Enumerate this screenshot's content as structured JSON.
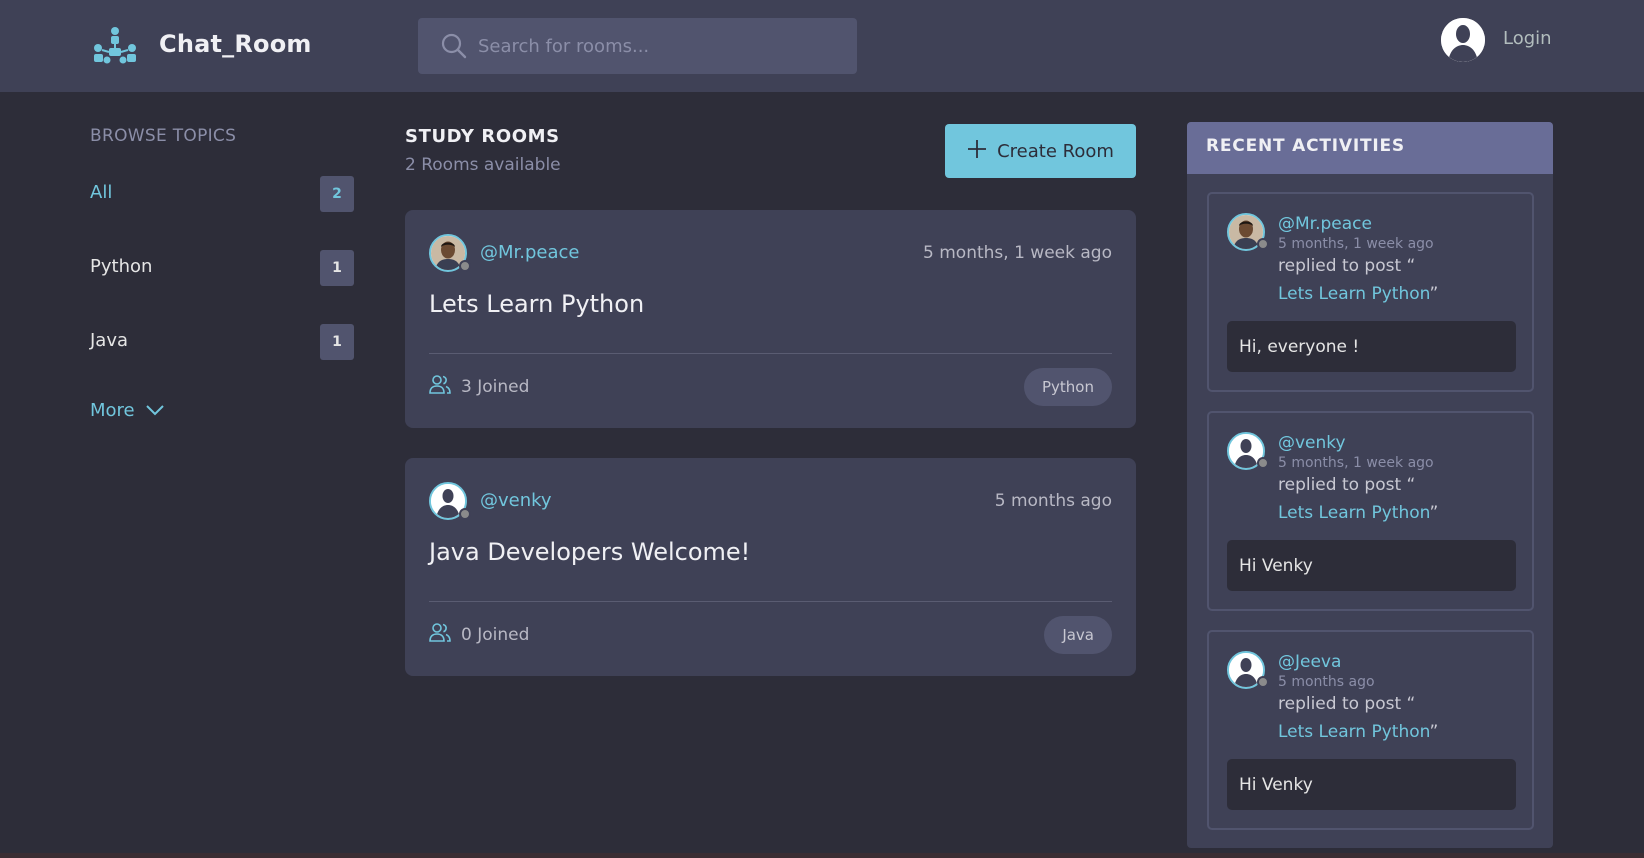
{
  "header": {
    "brand": "Chat_Room",
    "search_placeholder": "Search for rooms...",
    "login_label": "Login"
  },
  "sidebar": {
    "title": "BROWSE TOPICS",
    "topics": [
      {
        "name": "All",
        "count": "2"
      },
      {
        "name": "Python",
        "count": "1"
      },
      {
        "name": "Java",
        "count": "1"
      }
    ],
    "more_label": "More"
  },
  "main": {
    "title": "STUDY ROOMS",
    "subtitle": "2 Rooms available",
    "create_label": "Create Room",
    "rooms": [
      {
        "author": "@Mr.peace",
        "time": "5 months, 1 week ago",
        "title": "Lets Learn Python",
        "joined": "3 Joined",
        "tag": "Python"
      },
      {
        "author": "@venky",
        "time": "5 months ago",
        "title": "Java Developers Welcome!",
        "joined": "0 Joined",
        "tag": "Java"
      }
    ]
  },
  "activities": {
    "title": "RECENT ACTIVITIES",
    "items": [
      {
        "user": "@Mr.peace",
        "time": "5 months, 1 week ago",
        "action": "replied to post “",
        "post": "Lets Learn Python",
        "close": "”",
        "message": "Hi, everyone !"
      },
      {
        "user": "@venky",
        "time": "5 months, 1 week ago",
        "action": "replied to post “",
        "post": "Lets Learn Python",
        "close": "”",
        "message": "Hi Venky"
      },
      {
        "user": "@Jeeva",
        "time": "5 months ago",
        "action": "replied to post “",
        "post": "Lets Learn Python",
        "close": "”",
        "message": "Hi Venky"
      }
    ]
  },
  "colors": {
    "background": "#2d2d39",
    "panel": "#3f4156",
    "accent": "#71c6dd",
    "muted": "#8b8ea8",
    "activities_header": "#696d97"
  },
  "icons": [
    "logo-icon",
    "search-icon",
    "user-avatar-icon",
    "chevron-down-icon",
    "plus-icon",
    "users-icon"
  ]
}
